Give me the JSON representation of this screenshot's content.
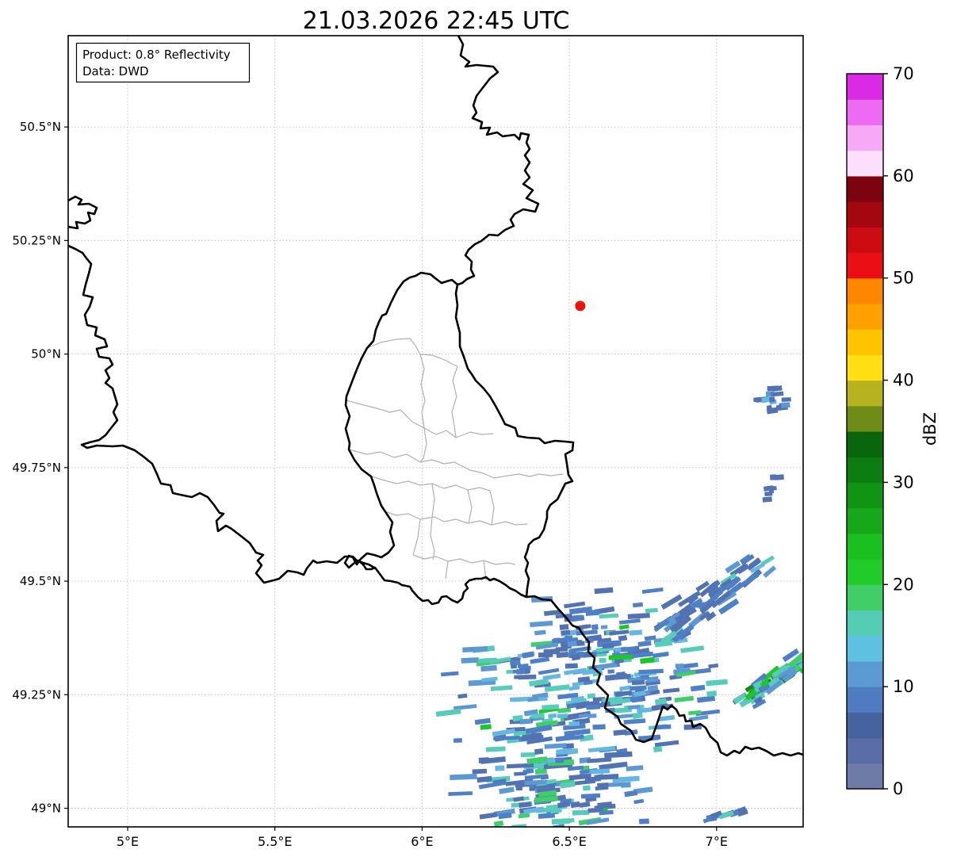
{
  "title": "21.03.2026 22:45 UTC",
  "info_box": {
    "line1": "Product: 0.8° Reflectivity",
    "line2": "Data: DWD"
  },
  "axes": {
    "x_ticks": [
      {
        "label": "5°E",
        "lon": 5.0
      },
      {
        "label": "5.5°E",
        "lon": 5.5
      },
      {
        "label": "6°E",
        "lon": 6.0
      },
      {
        "label": "6.5°E",
        "lon": 6.5
      },
      {
        "label": "7°E",
        "lon": 7.0
      }
    ],
    "y_ticks": [
      {
        "label": "49°N",
        "lat": 49.0
      },
      {
        "label": "49.25°N",
        "lat": 49.25
      },
      {
        "label": "49.5°N",
        "lat": 49.5
      },
      {
        "label": "49.75°N",
        "lat": 49.75
      },
      {
        "label": "50°N",
        "lat": 50.0
      },
      {
        "label": "50.25°N",
        "lat": 50.25
      },
      {
        "label": "50.5°N",
        "lat": 50.5
      }
    ],
    "lon_range": [
      4.798,
      7.294
    ],
    "lat_range": [
      48.959,
      50.701
    ],
    "grid": true
  },
  "colorbar": {
    "label": "dBZ",
    "min": 0,
    "max": 70,
    "step": 2.5,
    "tick_values": [
      0,
      10,
      20,
      30,
      40,
      50,
      60,
      70
    ],
    "colors_bottom_to_top": [
      "#6e7ba7",
      "#5a6da6",
      "#47639f",
      "#4f7cc0",
      "#5b9ad2",
      "#60c0e2",
      "#57ccb5",
      "#41ce68",
      "#21cb29",
      "#1cbf20",
      "#16a81a",
      "#119413",
      "#0d7c10",
      "#0a660c",
      "#6f8c18",
      "#b7b21f",
      "#ffe014",
      "#ffc400",
      "#ffa000",
      "#ff8700",
      "#ea0e15",
      "#cb0b12",
      "#a30710",
      "#7d030e",
      "#fcdffc",
      "#f7a9f7",
      "#ee6af2",
      "#d92be4"
    ]
  },
  "radar_marker": {
    "lon": 6.537,
    "lat": 50.106,
    "color": "#e8160c",
    "radius_px": 6.5
  },
  "radar_echoes": {
    "palette": {
      "p0": "#6b7aa6",
      "p1": "#5272b2",
      "p2": "#4f80c6",
      "p3": "#5d98d2",
      "p4": "#66b6e2",
      "p5": "#58cbbb",
      "p6": "#41cd6b",
      "p7": "#1fc62a",
      "p8": "#108a14"
    },
    "clusters": [
      {
        "name": "main-core",
        "kind": "blob",
        "seed": 11,
        "lon": 6.45,
        "lat": 49.16,
        "sig_lon": 0.15,
        "sig_lat": 0.1,
        "count": 170,
        "bar": [
          10,
          36
        ],
        "weights": {
          "p1": 26,
          "p2": 24,
          "p3": 16,
          "p4": 10,
          "p5": 16,
          "p6": 5,
          "p7": 2
        }
      },
      {
        "name": "north-arm",
        "kind": "blob",
        "seed": 23,
        "lon": 6.55,
        "lat": 49.37,
        "sig_lon": 0.085,
        "sig_lat": 0.05,
        "count": 55,
        "bar": [
          8,
          30
        ],
        "weights": {
          "p1": 45,
          "p2": 30,
          "p3": 10,
          "p4": 5,
          "p5": 8
        }
      },
      {
        "name": "east-lobe",
        "kind": "blob",
        "seed": 37,
        "lon": 6.72,
        "lat": 49.28,
        "sig_lon": 0.12,
        "sig_lat": 0.08,
        "count": 110,
        "bar": [
          10,
          32
        ],
        "weights": {
          "p1": 30,
          "p2": 24,
          "p3": 14,
          "p4": 8,
          "p5": 16,
          "p6": 6,
          "p7": 2
        }
      },
      {
        "name": "south-lobe",
        "kind": "blob",
        "seed": 41,
        "lon": 6.43,
        "lat": 49.01,
        "sig_lon": 0.13,
        "sig_lat": 0.045,
        "count": 65,
        "bar": [
          8,
          30
        ],
        "weights": {
          "p1": 34,
          "p2": 26,
          "p3": 12,
          "p4": 8,
          "p5": 14,
          "p6": 4,
          "p7": 2
        }
      },
      {
        "name": "ne-streaks",
        "kind": "streak",
        "seed": 53,
        "lon1": 6.82,
        "lat1": 49.385,
        "lon2": 7.17,
        "lat2": 49.55,
        "jitter": 20,
        "count": 60,
        "bar": [
          12,
          30
        ],
        "weights": {
          "p1": 55,
          "p2": 25,
          "p3": 8,
          "p4": 2,
          "p5": 10
        }
      },
      {
        "name": "east-green-cells",
        "kind": "streak",
        "seed": 67,
        "lon1": 7.08,
        "lat1": 49.23,
        "lon2": 7.31,
        "lat2": 49.33,
        "jitter": 13,
        "count": 75,
        "bar": [
          10,
          26
        ],
        "weights": {
          "p1": 14,
          "p2": 14,
          "p3": 8,
          "p5": 22,
          "p6": 16,
          "p7": 14,
          "p8": 12
        }
      },
      {
        "name": "spot-north",
        "kind": "blob",
        "seed": 71,
        "lon": 7.19,
        "lat": 49.905,
        "sig_lon": 0.03,
        "sig_lat": 0.015,
        "count": 16,
        "bar": [
          6,
          16
        ],
        "weights": {
          "p1": 70,
          "p3": 20,
          "p4": 10
        }
      },
      {
        "name": "spot-mid",
        "kind": "blob",
        "seed": 83,
        "lon": 7.185,
        "lat": 49.705,
        "sig_lon": 0.012,
        "sig_lat": 0.02,
        "count": 9,
        "bar": [
          5,
          12
        ],
        "weights": {
          "p1": 100
        }
      },
      {
        "name": "spot-west",
        "kind": "blob",
        "seed": 89,
        "lon": 6.33,
        "lat": 49.315,
        "sig_lon": 0.02,
        "sig_lat": 0.012,
        "count": 9,
        "bar": [
          6,
          14
        ],
        "weights": {
          "p1": 60,
          "p2": 40
        }
      },
      {
        "name": "south-streak",
        "kind": "streak",
        "seed": 97,
        "lon1": 6.96,
        "lat1": 48.975,
        "lon2": 7.1,
        "lat2": 49.0,
        "jitter": 6,
        "count": 12,
        "bar": [
          10,
          22
        ],
        "weights": {
          "p1": 60,
          "p2": 30,
          "p5": 10
        }
      }
    ]
  }
}
